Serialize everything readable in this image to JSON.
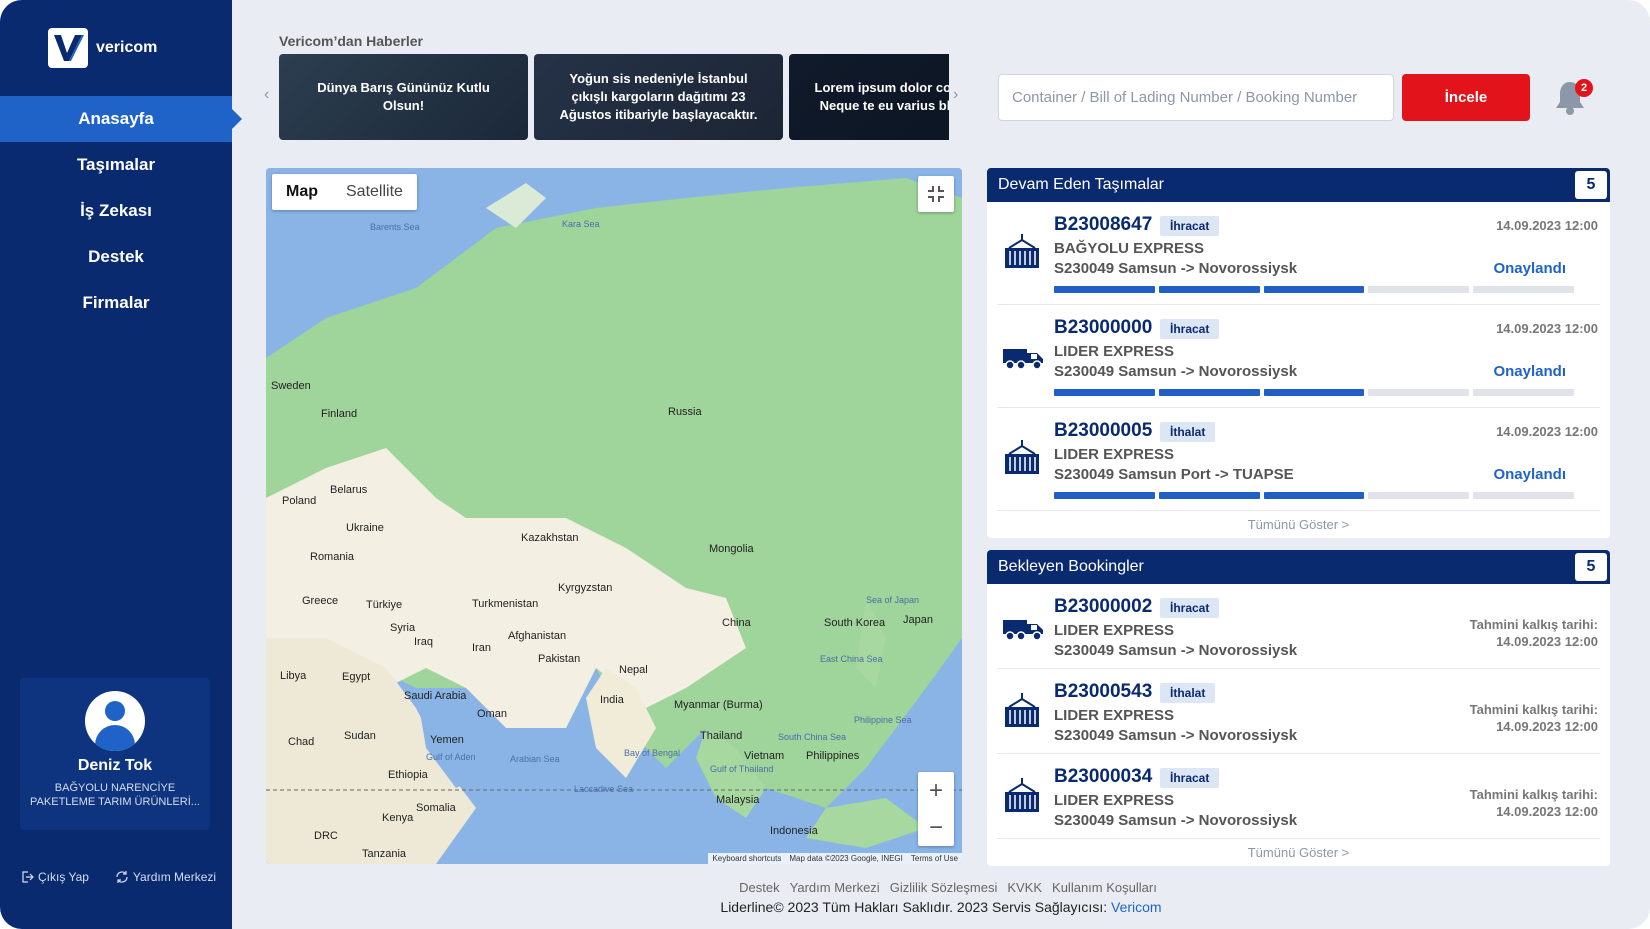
{
  "app": {
    "brand": "vericom",
    "accent": "#1f63c9",
    "navy": "#0a2a70",
    "red": "#e3131b"
  },
  "sidebar": {
    "items": [
      {
        "label": "Anasayfa",
        "active": true
      },
      {
        "label": "Taşımalar"
      },
      {
        "label": "İş Zekası"
      },
      {
        "label": "Destek"
      },
      {
        "label": "Firmalar"
      }
    ],
    "user": {
      "name": "Deniz Tok",
      "company": "BAĞYOLU NARENCİYE PAKETLEME TARIM ÜRÜNLERİ..."
    },
    "logout_label": "Çıkış Yap",
    "help_label": "Yardım Merkezi"
  },
  "news": {
    "title": "Vericom’dan Haberler",
    "items": [
      "Dünya Barış Gününüz Kutlu Olsun!",
      "Yoğun sis nedeniyle İstanbul çıkışlı kargoların dağıtımı 23 Ağustos itibariyle başlayacaktır.",
      "Lorem ipsum dolor consectetur. Neque te eu varius blandit et a"
    ]
  },
  "search": {
    "placeholder": "Container / Bill of Lading Number / Booking Number",
    "button": "İncele"
  },
  "notifications": {
    "count": "2"
  },
  "map": {
    "tabs": [
      "Map",
      "Satellite"
    ],
    "labels": {
      "barents": "Barents Sea",
      "kara": "Kara Sea",
      "sweden": "Sweden",
      "finland": "Finland",
      "russia": "Russia",
      "belarus": "Belarus",
      "poland": "Poland",
      "ukraine": "Ukraine",
      "romania": "Romania",
      "greece": "Greece",
      "turkiye": "Türkiye",
      "kazakhstan": "Kazakhstan",
      "mongolia": "Mongolia",
      "kyrgyzstan": "Kyrgyzstan",
      "turkmenistan": "Turkmenistan",
      "syria": "Syria",
      "iraq": "Iraq",
      "iran": "Iran",
      "afghanistan": "Afghanistan",
      "pakistan": "Pakistan",
      "china": "China",
      "south_korea": "South Korea",
      "japan": "Japan",
      "sea_of_japan": "Sea of Japan",
      "nepal": "Nepal",
      "libya": "Libya",
      "egypt": "Egypt",
      "saudi_arabia": "Saudi Arabia",
      "oman": "Oman",
      "india": "India",
      "myanmar": "Myanmar (Burma)",
      "east_china_sea": "East China Sea",
      "philippine_sea": "Philippine Sea",
      "chad": "Chad",
      "sudan": "Sudan",
      "yemen": "Yemen",
      "gulf_of_aden": "Gulf of Aden",
      "arabian_sea": "Arabian Sea",
      "bay_of_bengal": "Bay of Bengal",
      "thailand": "Thailand",
      "vietnam": "Vietnam",
      "philippines": "Philippines",
      "south_china_sea": "South China Sea",
      "ethiopia": "Ethiopia",
      "laccadive": "Laccadive Sea",
      "gulf_of_thailand": "Gulf of Thailand",
      "malaysia": "Malaysia",
      "somalia": "Somalia",
      "kenya": "Kenya",
      "indonesia": "Indonesia",
      "drc": "DRC",
      "tanzania": "Tanzania"
    },
    "attribution": [
      "Keyboard shortcuts",
      "Map data ©2023 Google, INEGI",
      "Terms of Use"
    ]
  },
  "ongoing": {
    "title": "Devam Eden Taşımalar",
    "count": "5",
    "show_all": "Tümünü Göster >",
    "items": [
      {
        "code": "B23008647",
        "type": "İhracat",
        "company": "BAĞYOLU EXPRESS",
        "route": "S230049 Samsun -> Novorossiysk",
        "date": "14.09.2023  12:00",
        "status": "Onaylandı",
        "icon": "container-ship-icon",
        "progress": 0.6
      },
      {
        "code": "B23000000",
        "type": "İhracat",
        "company": "LIDER EXPRESS",
        "route": "S230049 Samsun -> Novorossiysk",
        "date": "14.09.2023  12:00",
        "status": "Onaylandı",
        "icon": "truck-icon",
        "progress": 0.6
      },
      {
        "code": "B23000005",
        "type": "İthalat",
        "company": "LIDER EXPRESS",
        "route": "S230049 Samsun Port -> TUAPSE",
        "date": "14.09.2023  12:00",
        "status": "Onaylandı",
        "icon": "container-ship-icon",
        "progress": 0.6
      }
    ]
  },
  "pending": {
    "title": "Bekleyen Bookingler",
    "count": "5",
    "show_all": "Tümünü Göster >",
    "est_label": "Tahmini kalkış tarihi:",
    "items": [
      {
        "code": "B23000002",
        "type": "İhracat",
        "company": "LIDER EXPRESS",
        "route": "S230049 Samsun -> Novorossiysk",
        "date": "14.09.2023  12:00",
        "icon": "truck-icon"
      },
      {
        "code": "B23000543",
        "type": "İthalat",
        "company": "LIDER EXPRESS",
        "route": "S230049 Samsun -> Novorossiysk",
        "date": "14.09.2023  12:00",
        "icon": "container-ship-icon"
      },
      {
        "code": "B23000034",
        "type": "İhracat",
        "company": "LIDER EXPRESS",
        "route": "S230049 Samsun -> Novorossiysk",
        "date": "14.09.2023  12:00",
        "icon": "container-ship-icon"
      }
    ]
  },
  "footer": {
    "links": [
      "Destek",
      "Yardım Merkezi",
      "Gizlilik Sözleşmesi",
      "KVKK",
      "Kullanım Koşulları"
    ],
    "copyright": "Liderline© 2023 Tüm Hakları Saklıdır. 2023 Servis Sağlayıcısı:",
    "provider": "Vericom"
  }
}
